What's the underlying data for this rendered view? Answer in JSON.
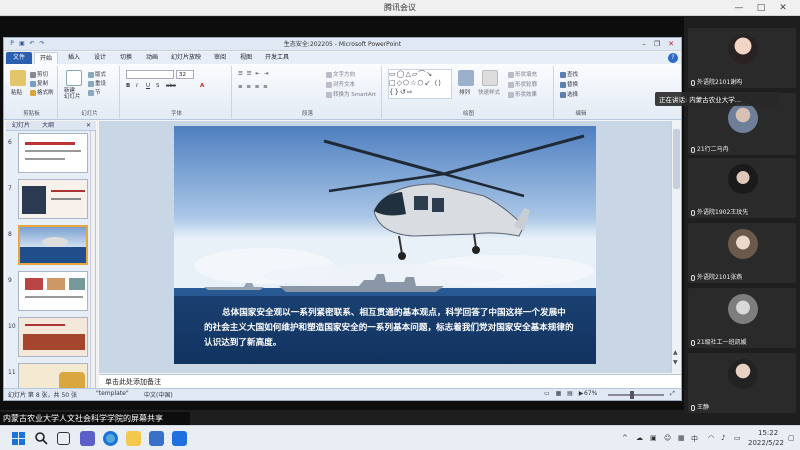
{
  "meeting": {
    "title": "腾讯会议",
    "win_min": "—",
    "win_max": "□",
    "win_close": "✕"
  },
  "ppt": {
    "title": "生态安全:202205  -  Microsoft PowerPoint",
    "tabs": [
      "文件",
      "开始",
      "插入",
      "设计",
      "切换",
      "动画",
      "幻灯片放映",
      "审阅",
      "视图",
      "开发工具"
    ],
    "groups": {
      "clipboard": "剪贴板",
      "slides": "幻灯片",
      "font": "字体",
      "paragraph": "段落",
      "drawing": "绘图",
      "editing": "编辑"
    },
    "buttons": {
      "paste": "粘贴",
      "cut": "剪切",
      "copy": "复制",
      "format_painter": "格式刷",
      "new_slide": "新建\n幻灯片",
      "layout": "版式",
      "reset": "重设",
      "section": "节",
      "font_size": "32",
      "text_direction": "文字方向",
      "align_text": "对齐文本",
      "smartart": "转换为 SmartArt",
      "arrange": "排列",
      "quick_styles": "快速样式",
      "shape_fill": "形状填充",
      "shape_outline": "形状轮廓",
      "shape_effect": "形状效果",
      "find": "查找",
      "replace": "替换",
      "select": "选择"
    },
    "panel_tabs": {
      "slides": "幻灯片",
      "outline": "大纲"
    },
    "slide_numbers": [
      "6",
      "7",
      "8",
      "9",
      "10",
      "11"
    ],
    "slide_text": "总体国家安全观以一系列紧密联系、相互贯通的基本观点，科学回答了中国这样一个发展中的社会主义大国如何维护和塑造国家安全的一系列基本问题，标志着我们党对国家安全基本规律的认识达到了新高度。",
    "notes_placeholder": "单击此处添加备注",
    "status": {
      "slide_info": "幻灯片 第 8 张，共 50 张",
      "theme": "\"template\"",
      "language": "中文(中国)",
      "zoom": "67%"
    }
  },
  "share_overlay": "内蒙古农业大学人文社会科学学院的屏幕共享",
  "speaking": "正在讲话: 内蒙古农业大学...",
  "participants": [
    {
      "name": "外语院2101谢昀"
    },
    {
      "name": "21行二马冉"
    },
    {
      "name": "外语院1902王玟先"
    },
    {
      "name": "外语院2101张燕"
    },
    {
      "name": "21级社工一班凯媛"
    },
    {
      "name": "王静"
    }
  ],
  "clock": {
    "time": "15:22",
    "date": "2022/5/22"
  },
  "tray": {
    "lang": "中"
  },
  "colors": {
    "ribbon_blue": "#2a5fb0",
    "sea": "#1f4e8a",
    "sky": "#6c93c8"
  }
}
